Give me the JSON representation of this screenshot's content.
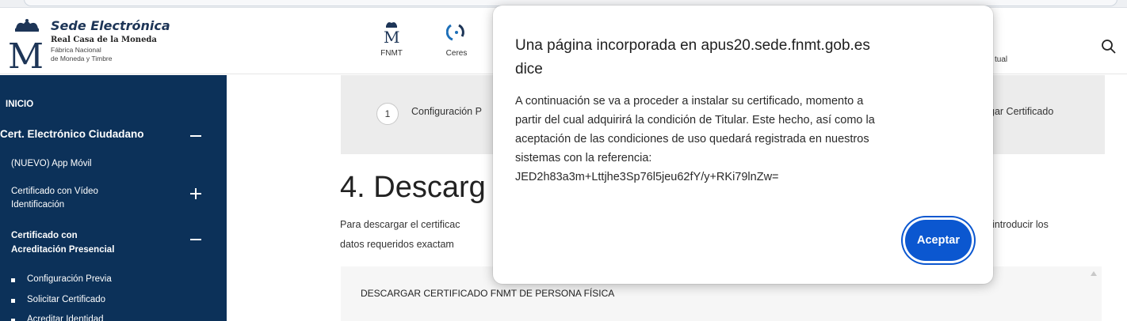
{
  "header": {
    "brand_title": "Sede Electrónica",
    "brand_sub1": "Real Casa de la Moneda",
    "brand_sub2": "Fábrica Nacional",
    "brand_sub3": "de Moneda y Timbre",
    "nav": [
      {
        "label": "FNMT",
        "icon": "crown-m-icon"
      },
      {
        "label": "Ceres",
        "icon": "ceres-icon"
      }
    ],
    "nav_partial": "tual",
    "search_icon": "search-icon"
  },
  "sidebar": {
    "items": [
      {
        "label": "INICIO"
      },
      {
        "label": "Cert. Electrónico Ciudadano",
        "toggle": "minus"
      },
      {
        "label": "(NUEVO) App Móvil"
      },
      {
        "label_line1": "Certificado con Vídeo",
        "label_line2": "Identificación",
        "toggle": "plus"
      },
      {
        "label_line1": "Certificado con",
        "label_line2": "Acreditación Presencial",
        "toggle": "minus"
      },
      {
        "label": "Configuración Previa"
      },
      {
        "label": "Solicitar Certificado"
      },
      {
        "label": "Acreditar Identidad"
      }
    ]
  },
  "main": {
    "step_number": "1",
    "step_label": "Configuración P",
    "step_label_right": "gar Certificado",
    "heading": "4. Descarg",
    "para1": "Para descargar el certificac",
    "para1_right": "introducir los",
    "para2": "datos requeridos exactam",
    "card_title": "DESCARGAR CERTIFICADO FNMT DE PERSONA FÍSICA"
  },
  "dialog": {
    "title_line1": "Una página incorporada en apus20.sede.fnmt.gob.es",
    "title_line2": "dice",
    "message_lines": [
      "A continuación se va a proceder a instalar su certificado, momento a",
      "partir del cual adquirirá la condición de Titular. Este hecho, así como la",
      "aceptación de las condiciones de uso quedará registrada en nuestros",
      "sistemas con la referencia:",
      "JED2h83a3m+Lttjhe3Sp76l5jeu62fY/y+RKi79lnZw="
    ],
    "accept_label": "Aceptar"
  },
  "colors": {
    "sidebar_bg": "#0c3159",
    "accent_button": "#0b57d0",
    "brand_title": "#1d3557"
  }
}
